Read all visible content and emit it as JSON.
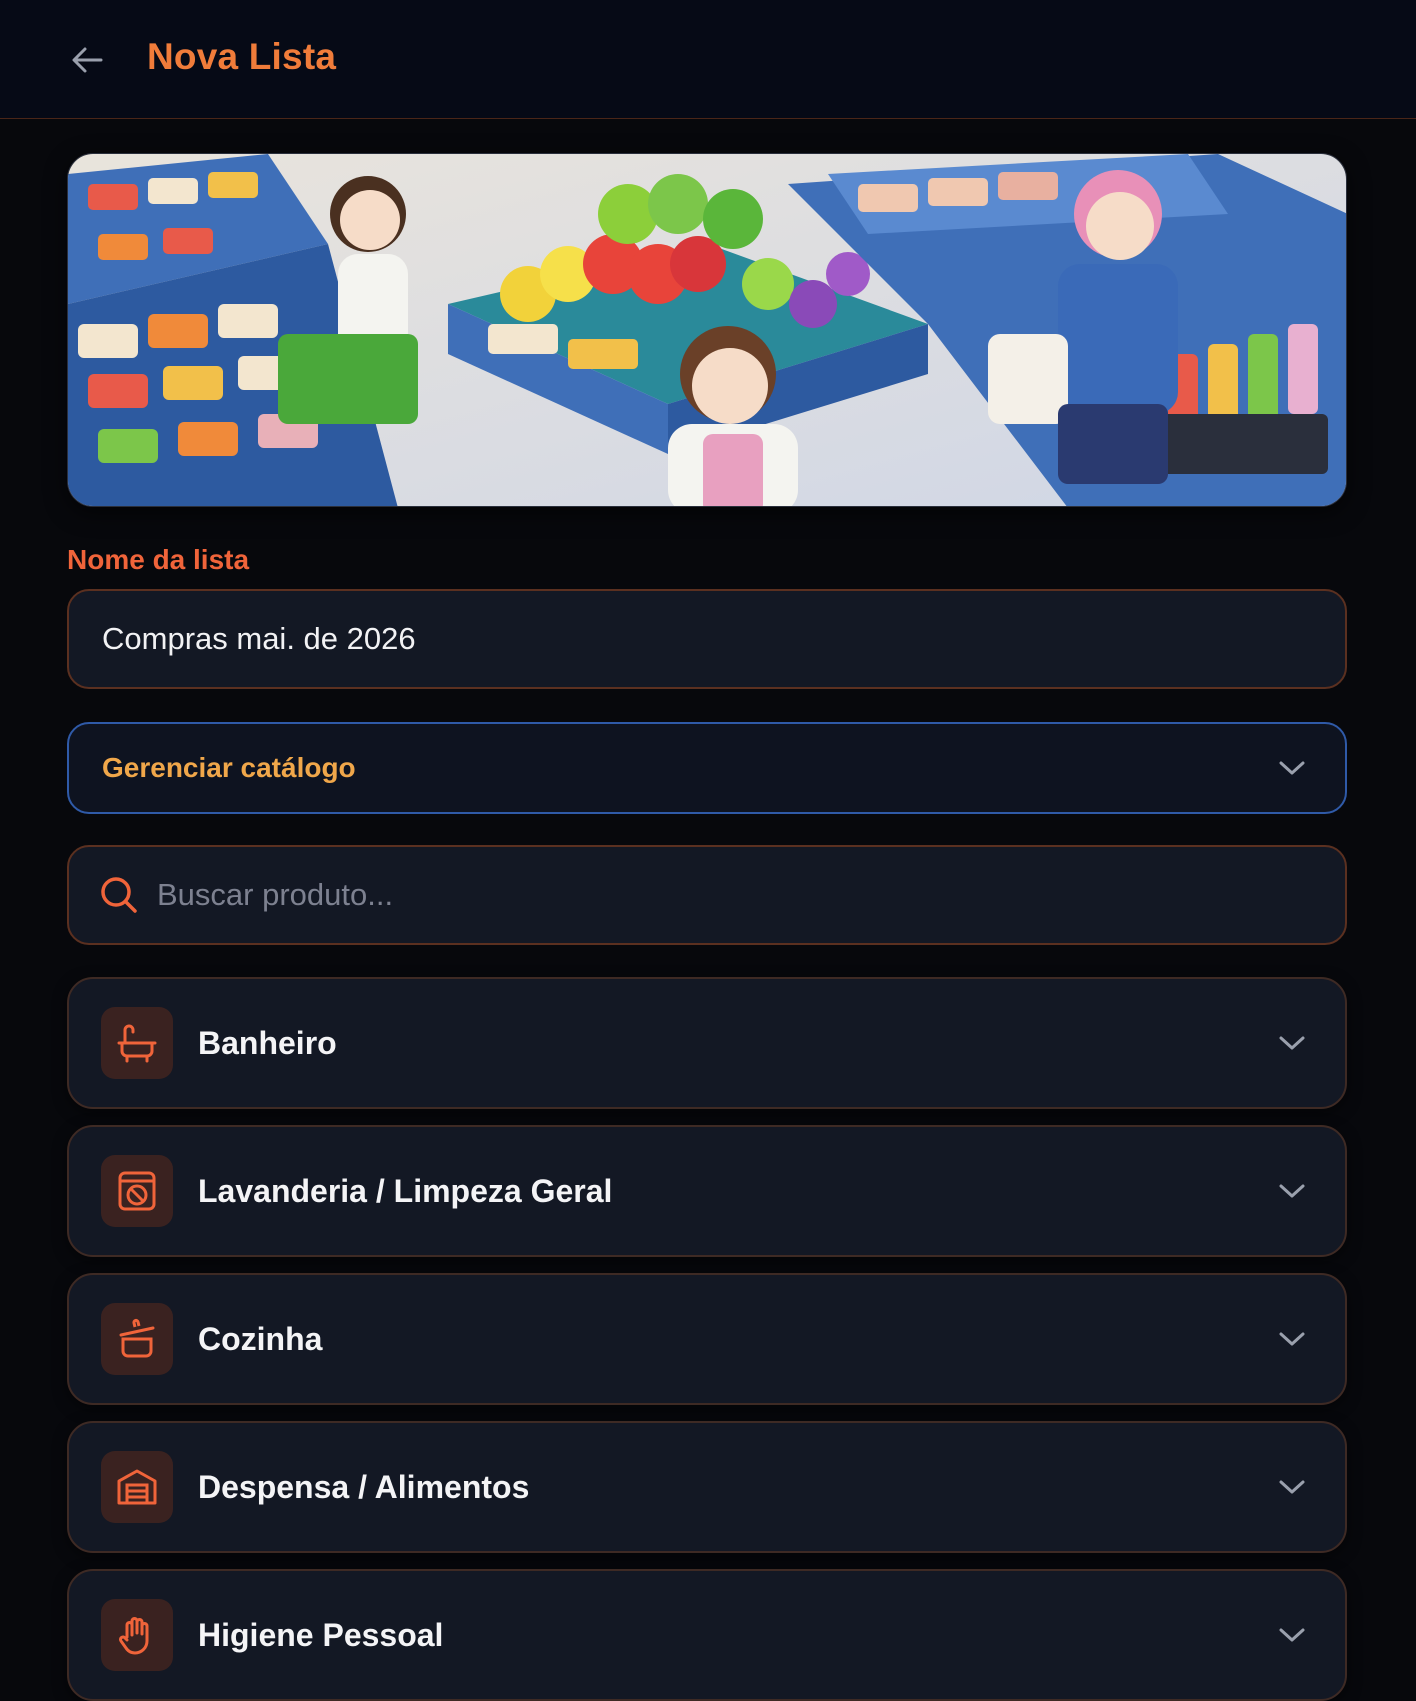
{
  "header": {
    "title": "Nova Lista",
    "back_icon": "arrow-left-icon"
  },
  "hero": {
    "image": "supermarket-anime-banner"
  },
  "form": {
    "name_label": "Nome da lista",
    "name_value": "Compras mai. de 2026",
    "catalog_label": "Gerenciar catálogo",
    "search_placeholder": "Buscar produto..."
  },
  "categories": [
    {
      "label": "Banheiro",
      "icon": "bathtub-icon"
    },
    {
      "label": "Lavanderia / Limpeza Geral",
      "icon": "washing-machine-icon"
    },
    {
      "label": "Cozinha",
      "icon": "cooking-pot-icon"
    },
    {
      "label": "Despensa / Alimentos",
      "icon": "pantry-icon"
    },
    {
      "label": "Higiene Pessoal",
      "icon": "hand-icon"
    }
  ],
  "colors": {
    "accent": "#f07c3a",
    "catalog_text": "#f0a74a",
    "catalog_border": "#2f5aa8",
    "card_bg": "#131824"
  }
}
